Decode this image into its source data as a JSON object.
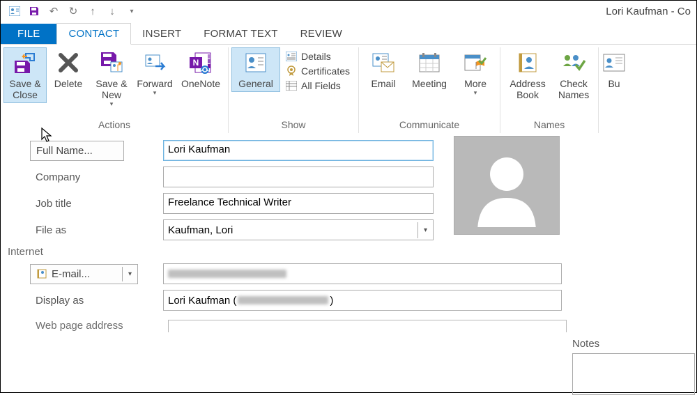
{
  "window": {
    "title": "Lori Kaufman - Co"
  },
  "qat": {
    "contact_card": "contact-card",
    "save": "save",
    "undo": "undo",
    "redo": "redo",
    "up": "up",
    "down": "down",
    "more": "more"
  },
  "tabs": {
    "file": "FILE",
    "contact": "CONTACT",
    "insert": "INSERT",
    "format_text": "FORMAT TEXT",
    "review": "REVIEW"
  },
  "ribbon": {
    "actions": {
      "label": "Actions",
      "save_close": "Save & Close",
      "delete": "Delete",
      "save_new": "Save & New",
      "forward": "Forward",
      "onenote": "OneNote"
    },
    "show": {
      "label": "Show",
      "general": "General",
      "details": "Details",
      "certificates": "Certificates",
      "all_fields": "All Fields"
    },
    "communicate": {
      "label": "Communicate",
      "email": "Email",
      "meeting": "Meeting",
      "more": "More"
    },
    "names": {
      "label": "Names",
      "address_book": "Address Book",
      "check_names": "Check Names"
    },
    "options": {
      "bu": "Bu"
    }
  },
  "form": {
    "full_name_btn": "Full Name...",
    "full_name_val": "Lori Kaufman",
    "company_lbl": "Company",
    "company_val": "",
    "job_title_lbl": "Job title",
    "job_title_val": "Freelance Technical Writer",
    "file_as_lbl": "File as",
    "file_as_val": "Kaufman, Lori",
    "internet_lbl": "Internet",
    "email_btn": "E-mail...",
    "email_val": "",
    "display_as_lbl": "Display as",
    "display_as_val": "Lori Kaufman (",
    "display_as_suffix": ")",
    "web_lbl": "Web page address",
    "notes_lbl": "Notes"
  }
}
